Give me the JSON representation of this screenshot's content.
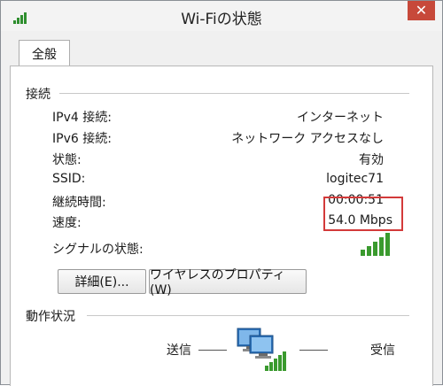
{
  "window": {
    "title": "Wi-Fiの状態",
    "close_glyph": "✕"
  },
  "tabs": [
    {
      "label": "全般"
    }
  ],
  "connection": {
    "group_label": "接続",
    "rows": [
      {
        "label": "IPv4 接続:",
        "value": "インターネット"
      },
      {
        "label": "IPv6 接続:",
        "value": "ネットワーク アクセスなし"
      },
      {
        "label": "状態:",
        "value": "有効"
      },
      {
        "label": "SSID:",
        "value": "logitec71"
      },
      {
        "label": "継続時間:",
        "value": "00:00:51"
      },
      {
        "label": "速度:",
        "value": "54.0 Mbps"
      }
    ],
    "signal_label": "シグナルの状態:",
    "signal_bars": 5
  },
  "buttons": {
    "details": "詳細(E)...",
    "wireless_properties": "ワイヤレスのプロパティ(W)"
  },
  "activity": {
    "group_label": "動作状況",
    "sent_label": "送信",
    "received_label": "受信"
  },
  "colors": {
    "highlight": "#d33a3a",
    "signal_green": "#3a9a2e",
    "close_red": "#c7493a"
  }
}
